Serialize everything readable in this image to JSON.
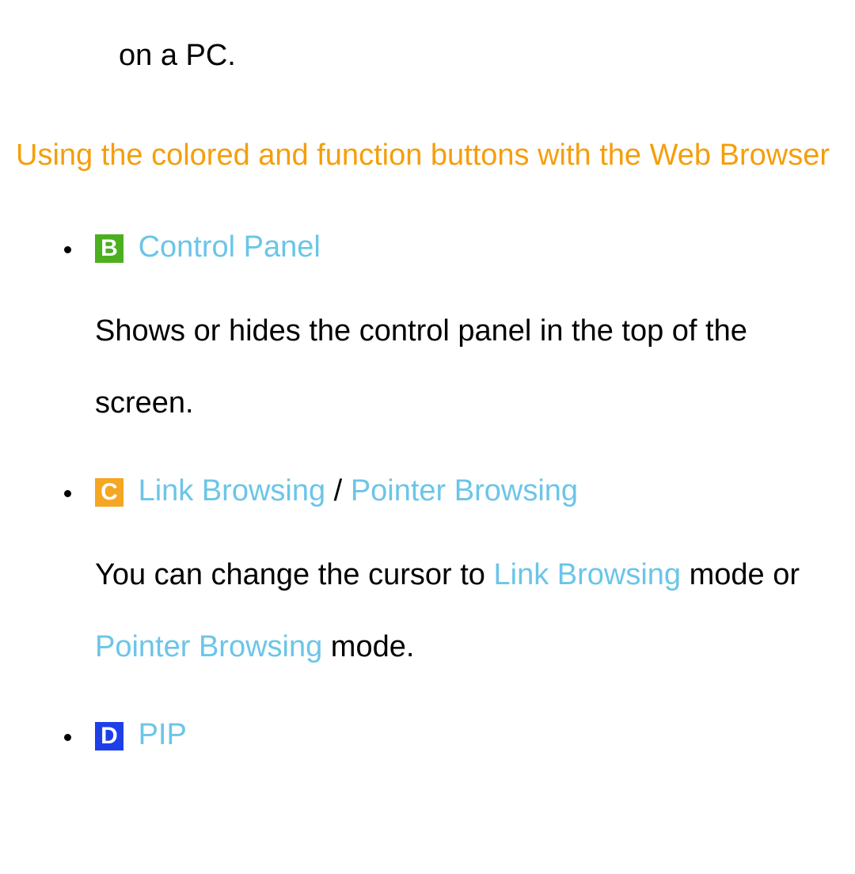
{
  "fragment_top": "on a PC.",
  "heading": "Using the colored and function buttons with the Web Browser",
  "items": [
    {
      "badge": "B",
      "title": "Control Panel",
      "desc_plain": "Shows or hides the control panel in the top of the screen."
    },
    {
      "badge": "C",
      "title_a": "Link Browsing",
      "title_sep": " / ",
      "title_b": "Pointer Browsing",
      "desc_pre": "You can change the cursor to ",
      "desc_link1": "Link Browsing",
      "desc_mid": " mode or ",
      "desc_link2": "Pointer Browsing",
      "desc_post": " mode."
    },
    {
      "badge": "D",
      "title": "PIP"
    }
  ]
}
